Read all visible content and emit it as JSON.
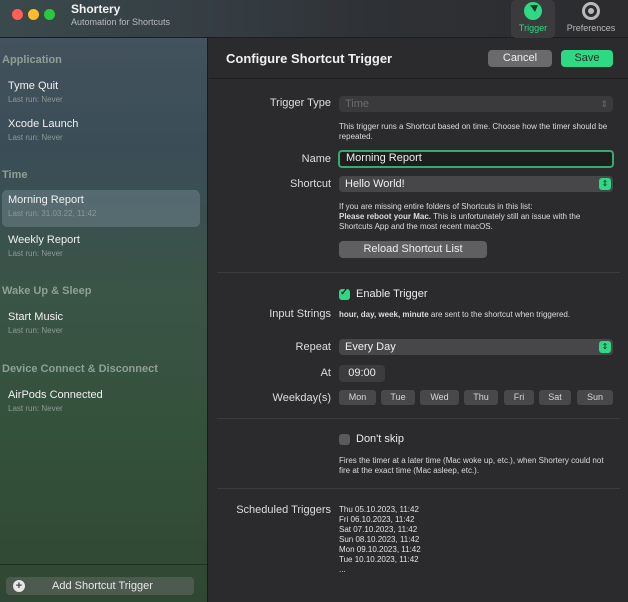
{
  "window": {
    "app_name": "Shortery",
    "app_subtitle": "Automation for Shortcuts",
    "tabs": [
      {
        "label": "Trigger",
        "icon": "bolt-icon",
        "selected": true
      },
      {
        "label": "Preferences",
        "icon": "gear-icon",
        "selected": false
      }
    ]
  },
  "sidebar": {
    "sections": [
      {
        "title": "Application",
        "items": [
          {
            "name": "Tyme Quit",
            "sub": "Last run: Never"
          },
          {
            "name": "Xcode Launch",
            "sub": "Last run: Never"
          }
        ]
      },
      {
        "title": "Time",
        "items": [
          {
            "name": "Morning Report",
            "sub": "Last run: 31.03.22, 11:42",
            "selected": true
          },
          {
            "name": "Weekly Report",
            "sub": "Last run: Never"
          }
        ]
      },
      {
        "title": "Wake Up & Sleep",
        "items": [
          {
            "name": "Start Music",
            "sub": "Last run: Never"
          }
        ]
      },
      {
        "title": "Device Connect & Disconnect",
        "items": [
          {
            "name": "AirPods Connected",
            "sub": "Last run: Never"
          }
        ]
      }
    ],
    "add_button": "Add Shortcut Trigger"
  },
  "main": {
    "title": "Configure Shortcut Trigger",
    "cancel_label": "Cancel",
    "save_label": "Save",
    "trigger_type": {
      "label": "Trigger Type",
      "value": "Time",
      "help": "This trigger runs a Shortcut based on time. Choose how the timer should be repeated."
    },
    "name": {
      "label": "Name",
      "value": "Morning Report"
    },
    "shortcut": {
      "label": "Shortcut",
      "value": "Hello World!",
      "help_1": "If you are missing entire folders of Shortcuts in this list:",
      "help_2_bold": "Please reboot your Mac.",
      "help_2_rest": " This is unfortunately still an issue with the Shortcuts App and the most recent macOS.",
      "reload_label": "Reload Shortcut List"
    },
    "enable_trigger": {
      "label": "Enable Trigger",
      "checked": true
    },
    "input_strings": {
      "label": "Input Strings",
      "bold": "hour, day, week, minute",
      "rest": " are sent to the shortcut when triggered."
    },
    "repeat": {
      "label": "Repeat",
      "value": "Every Day"
    },
    "at": {
      "label": "At",
      "value": "09:00"
    },
    "weekdays": {
      "label": "Weekday(s)",
      "days": [
        "Mon",
        "Tue",
        "Wed",
        "Thu",
        "Fri",
        "Sat",
        "Sun"
      ]
    },
    "dont_skip": {
      "label": "Don't skip",
      "checked": false,
      "help": "Fires the timer at a later time (Mac woke up, etc.), when Shortery could not fire at the exact time (Mac asleep, etc.)."
    },
    "scheduled": {
      "label": "Scheduled Triggers",
      "items": [
        "Thu 05.10.2023, 11:42",
        "Fri 06.10.2023, 11:42",
        "Sat 07.10.2023, 11:42",
        "Sun 08.10.2023, 11:42",
        "Mon 09.10.2023, 11:42",
        "Tue 10.10.2023, 11:42",
        "..."
      ]
    }
  },
  "colors": {
    "accent": "#2fd882",
    "sidebar_top": "#43525c",
    "sidebar_bottom": "#2f4733",
    "background": "#2b2b2d"
  }
}
